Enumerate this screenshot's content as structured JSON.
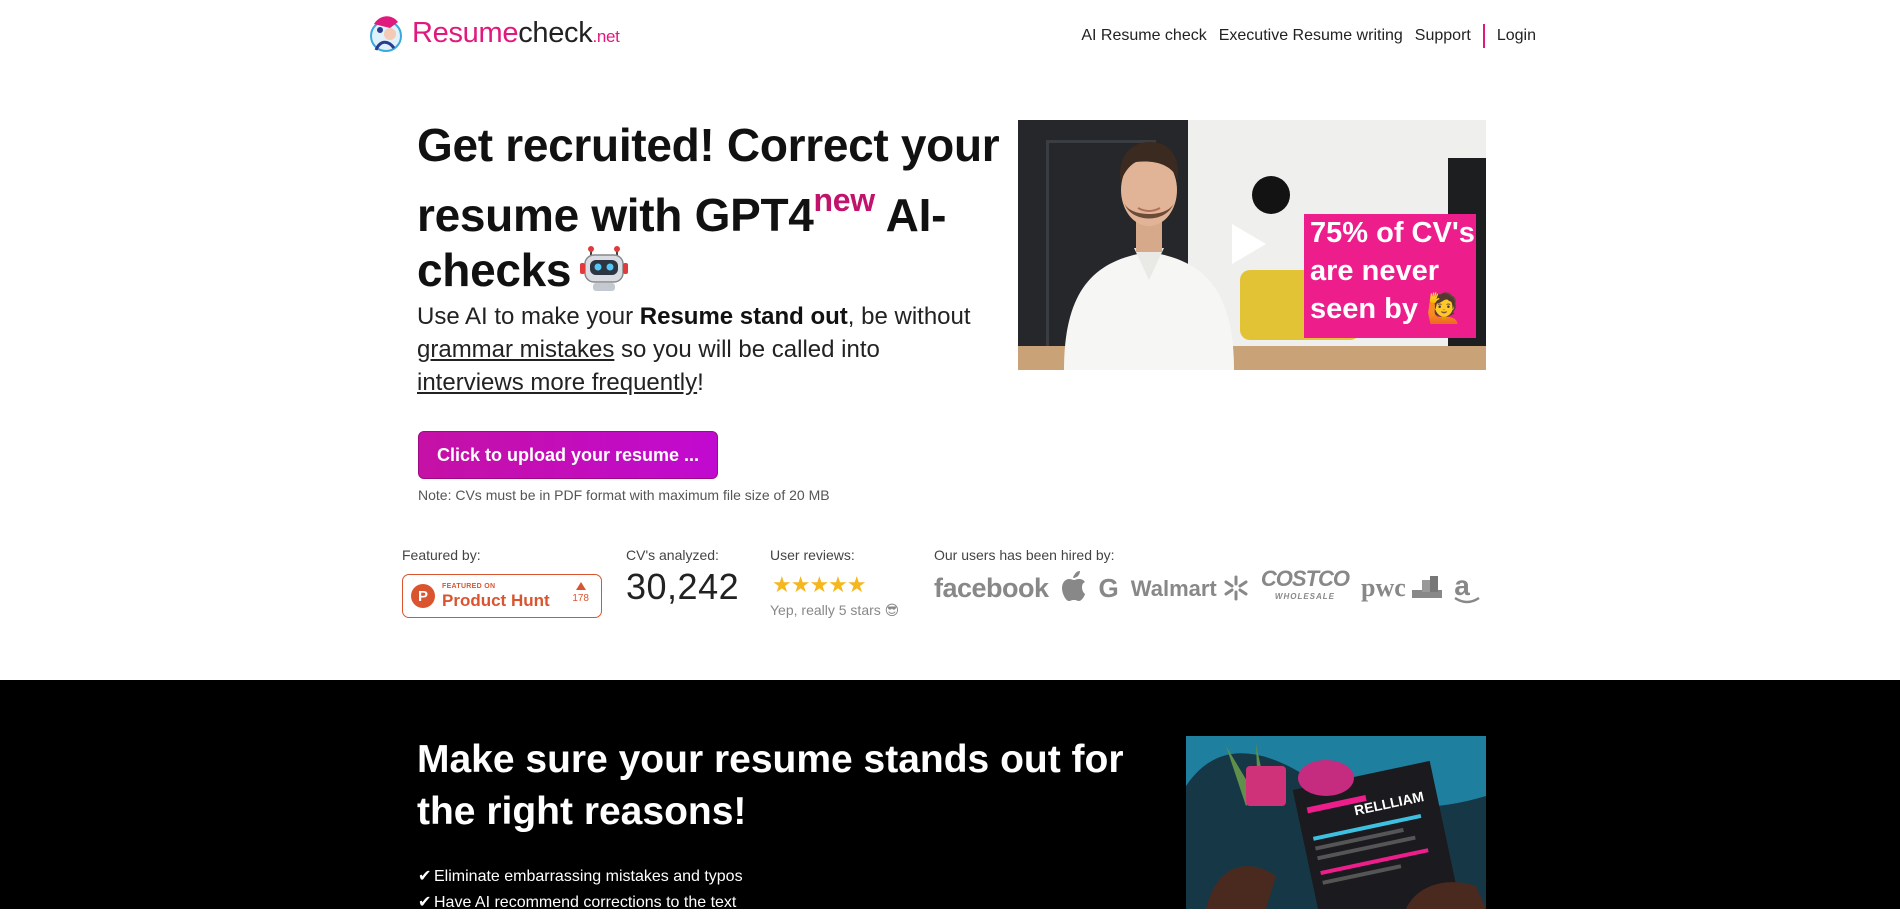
{
  "nav": {
    "logo": {
      "part1": "Resume",
      "part2": "check",
      "tld": ".net"
    },
    "links": [
      "AI Resume check",
      "Executive Resume writing",
      "Support"
    ],
    "login": "Login"
  },
  "hero": {
    "title_line1": "Get recruited! Correct your",
    "title_line2a": "resume with GPT4",
    "title_sup": "new",
    "title_line2b": " AI-",
    "title_line3": "checks",
    "sub_a": "Use AI to make your ",
    "sub_bold": "Resume stand out",
    "sub_b": ", be without",
    "sub_u1": "grammar mistakes",
    "sub_c": " so you will be called into",
    "sub_u2": "interviews more frequently",
    "sub_d": "!",
    "upload_label": "Click to upload your resume ...",
    "note": "Note: CVs must be in PDF format with maximum file size of 20 MB"
  },
  "video": {
    "overlay_lines": [
      "75% of CV's",
      "are never",
      "seen by 🙋"
    ]
  },
  "stats": {
    "featured_label": "Featured by:",
    "ph_small": "FEATURED ON",
    "ph_big": "Product Hunt",
    "ph_votes": "178",
    "cvs_label": "CV's analyzed:",
    "cvs_count": "30,242",
    "reviews_label": "User reviews:",
    "stars": "★★★★★",
    "stars_note": "Yep, really 5 stars 😎",
    "hired_label": "Our users has been hired by:",
    "logos": {
      "facebook": "facebook",
      "apple": "",
      "google": "G",
      "walmart": "Walmart",
      "costco": "COSTCO",
      "costco_sub": "WHOLESALE",
      "pwc": "pwc",
      "amazon": "a"
    }
  },
  "dark": {
    "title_line1": "Make sure your resume stands out for",
    "title_line2": "the right reasons!",
    "bullets": [
      "Eliminate embarrassing mistakes and typos",
      "Have AI recommend corrections to the text"
    ],
    "image_text": "RELLLIAM"
  },
  "colors": {
    "brand": "#e0197d",
    "button": "#c511a5",
    "producthunt": "#da552f",
    "star": "#f6b71e"
  }
}
